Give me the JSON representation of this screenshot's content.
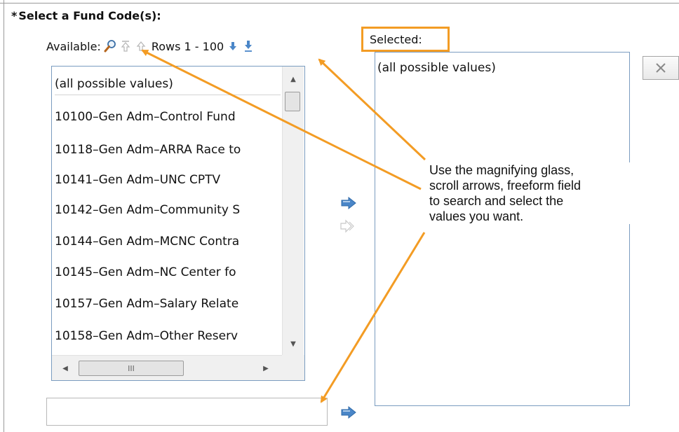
{
  "form": {
    "required_marker": "*",
    "heading": "Select a Fund Code(s):"
  },
  "available": {
    "label": "Available:",
    "rows_text": "Rows 1 - 100",
    "icons": {
      "search": "magnifying-glass-icon",
      "first": "first-page-arrow-icon",
      "previous": "previous-page-arrow-icon",
      "next": "next-page-arrow-icon",
      "last": "last-page-arrow-icon"
    },
    "items": [
      "(all possible values)",
      "10100–Gen Adm–Control Fund",
      "10118–Gen Adm–ARRA Race to",
      "10141–Gen Adm–UNC CPTV",
      "10142–Gen Adm–Community S",
      "10144–Gen Adm–MCNC Contra",
      "10145–Gen Adm–NC Center fo",
      "10157–Gen Adm–Salary Relate",
      "10158–Gen Adm–Other Reserv"
    ],
    "hscroll_grip": "III"
  },
  "selected": {
    "label": "Selected:",
    "items": [
      "(all possible values)"
    ]
  },
  "search_input": {
    "value": "",
    "placeholder": ""
  },
  "annotation": {
    "text": "Use the magnifying glass,\nscroll arrows, freeform field\nto search and select the\nvalues you want."
  },
  "colors": {
    "highlight": "#f39c24",
    "arrow_blue": "#4a86c8",
    "list_border": "#7a9cc0"
  }
}
